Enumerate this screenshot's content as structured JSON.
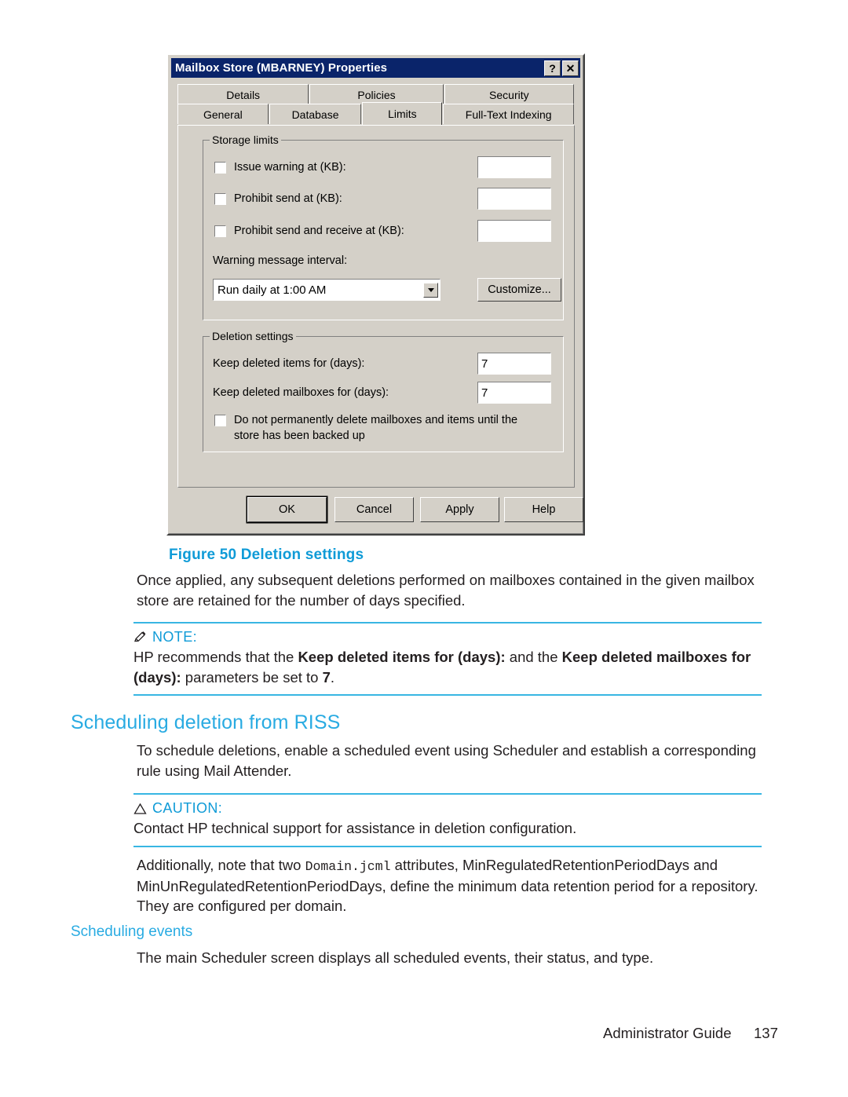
{
  "figure": {
    "dialog": {
      "title": "Mailbox Store (MBARNEY) Properties",
      "help_button": "?",
      "close_button": "✕",
      "tabs_top": [
        "Details",
        "Policies",
        "Security"
      ],
      "tabs_bottom": [
        "General",
        "Database",
        "Limits",
        "Full-Text Indexing"
      ],
      "active_tab": "Limits",
      "storage_limits": {
        "group_label": "Storage limits",
        "issue_warning_label": "Issue warning at (KB):",
        "issue_warning_value": "",
        "issue_warning_checked": false,
        "prohibit_send_label": "Prohibit send at (KB):",
        "prohibit_send_value": "",
        "prohibit_send_checked": false,
        "prohibit_send_receive_label": "Prohibit send and receive at (KB):",
        "prohibit_send_receive_value": "",
        "prohibit_send_receive_checked": false,
        "warning_interval_label": "Warning message interval:",
        "warning_interval_value": "Run daily at 1:00 AM",
        "customize_button": "Customize..."
      },
      "deletion_settings": {
        "group_label": "Deletion settings",
        "keep_items_label": "Keep deleted items for (days):",
        "keep_items_value": "7",
        "keep_mailboxes_label": "Keep deleted mailboxes for (days):",
        "keep_mailboxes_value": "7",
        "no_permanent_delete_label": "Do not permanently delete mailboxes and items until the store has been backed up",
        "no_permanent_delete_checked": false
      },
      "buttons": {
        "ok": "OK",
        "cancel": "Cancel",
        "apply": "Apply",
        "help": "Help"
      }
    },
    "caption": "Figure 50 Deletion settings"
  },
  "document": {
    "intro_paragraph": "Once applied, any subsequent deletions performed on mailboxes contained in the given mailbox store are retained for the number of days specified.",
    "note": {
      "label": "NOTE:",
      "text_part1": "HP recommends that the ",
      "bold1": "Keep deleted items for (days):",
      "text_part2": " and the ",
      "bold2": "Keep deleted mailboxes for (days):",
      "text_part3": " parameters be set to ",
      "bold3": "7",
      "text_part4": "."
    },
    "heading_scheduling_deletion": "Scheduling deletion from RISS",
    "scheduling_deletion_paragraph": "To schedule deletions, enable a scheduled event using Scheduler and establish a corresponding rule using Mail Attender.",
    "caution": {
      "label": "CAUTION:",
      "text": "Contact HP technical support for assistance in deletion configuration."
    },
    "domain_paragraph_part1": "Additionally, note that two ",
    "domain_paragraph_mono": "Domain.jcml",
    "domain_paragraph_part2": " attributes, MinRegulatedRetentionPeriodDays and MinUnRegulatedRetentionPeriodDays, define the minimum data retention period for a repository. They are configured per domain.",
    "heading_scheduling_events": "Scheduling events",
    "scheduling_events_paragraph": "The main Scheduler screen displays all scheduled events, their status, and type."
  },
  "footer": {
    "guide": "Administrator Guide",
    "page": "137"
  },
  "colors": {
    "accent_blue": "#29abe2",
    "caption_blue": "#0f9bd7",
    "rule_blue": "#38b6e3",
    "titlebar_blue": "#0a246a",
    "dialog_face": "#d4d0c8"
  }
}
